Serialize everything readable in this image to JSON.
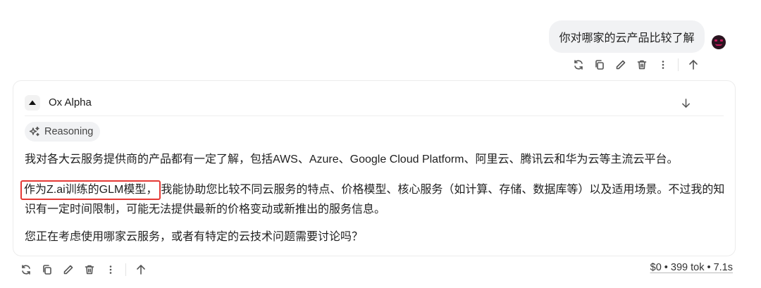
{
  "user_message": {
    "text": "你对哪家的云产品比较了解"
  },
  "user_toolbar": {
    "icons": [
      "refresh-icon",
      "copy-icon",
      "edit-icon",
      "delete-icon",
      "more-icon",
      "arrow-up-icon"
    ]
  },
  "assistant": {
    "model_name": "Ox Alpha",
    "reasoning_label": "Reasoning",
    "paragraph_1": "我对各大云服务提供商的产品都有一定了解，包括AWS、Azure、Google Cloud Platform、阿里云、腾讯云和华为云等主流云平台。",
    "paragraph_2_highlight": "作为Z.ai训练的GLM模型，",
    "paragraph_2_rest": "我能协助您比较不同云服务的特点、价格模型、核心服务（如计算、存储、数据库等）以及适用场景。不过我的知",
    "paragraph_2_line2": "识有一定时间限制，可能无法提供最新的价格变动或新推出的服务信息。",
    "paragraph_3": "您正在考虑使用哪家云服务，或者有特定的云技术问题需要讨论吗？"
  },
  "assistant_toolbar": {
    "icons": [
      "refresh-icon",
      "copy-icon",
      "edit-icon",
      "delete-icon",
      "more-icon",
      "arrow-up-icon"
    ]
  },
  "meta": {
    "stats": "$0 • 399 tok • 7.1s"
  },
  "colors": {
    "highlight_border": "#e53935",
    "bubble_bg": "#f1f2f4"
  }
}
